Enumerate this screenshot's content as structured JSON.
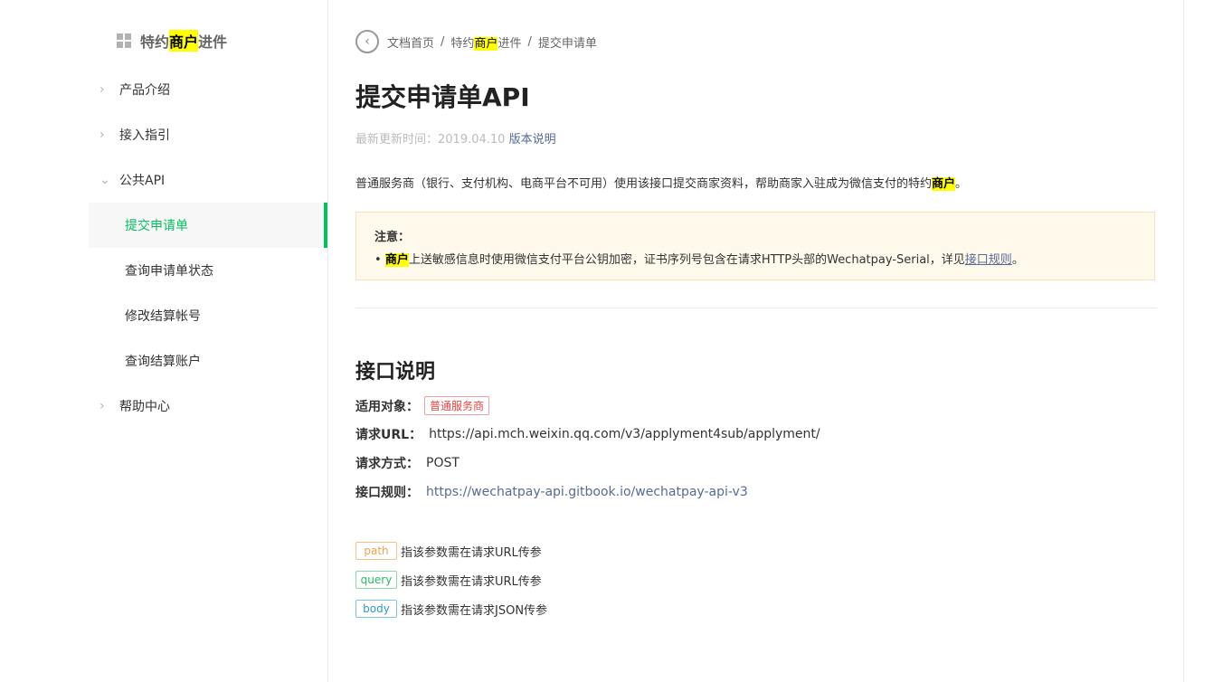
{
  "sidebar": {
    "brand": {
      "pre": "特约",
      "highlight": "商户",
      "post": "进件"
    },
    "items": [
      {
        "label": "产品介绍",
        "chevron": "›"
      },
      {
        "label": "接入指引",
        "chevron": "›"
      },
      {
        "label": "公共API",
        "chevron": "⌄"
      }
    ],
    "sub_items": [
      {
        "label": "提交申请单"
      },
      {
        "label": "查询申请单状态"
      },
      {
        "label": "修改结算帐号"
      },
      {
        "label": "查询结算账户"
      }
    ],
    "help": {
      "label": "帮助中心",
      "chevron": "›"
    }
  },
  "breadcrumb": {
    "back_icon": "‹",
    "home": "文档首页",
    "sep": "/",
    "section_pre": "特约",
    "section_highlight": "商户",
    "section_post": "进件",
    "current": "提交申请单"
  },
  "page": {
    "title": "提交申请单API",
    "update_label": "最新更新时间：2019.04.10",
    "version_link": "版本说明",
    "intro_pre": "普通服务商（银行、支付机构、电商平台不可用）使用该接口提交商家资料，帮助商家入驻成为微信支付的特约",
    "intro_highlight": "商户",
    "intro_post": "。"
  },
  "notice": {
    "title": "注意：",
    "bullet": "• ",
    "highlight": "商户",
    "text": "上送敏感信息时使用微信支付平台公钥加密，证书序列号包含在请求HTTP头部的Wechatpay-Serial，详见",
    "link": "接口规则",
    "end": "。"
  },
  "api": {
    "heading": "接口说明",
    "target_label": "适用对象：",
    "target_tag": "普通服务商",
    "url_label": "请求URL：",
    "url": "https://api.mch.weixin.qq.com/v3/applyment4sub/applyment/",
    "method_label": "请求方式：",
    "method": "POST",
    "rules_label": "接口规则：",
    "rules_link": "https://wechatpay-api.gitbook.io/wechatpay-api-v3"
  },
  "params": [
    {
      "tag": "path",
      "desc": "指该参数需在请求URL传参"
    },
    {
      "tag": "query",
      "desc": "指该参数需在请求URL传参"
    },
    {
      "tag": "body",
      "desc": "指该参数需在请求JSON传参"
    }
  ],
  "colors": {
    "accent": "#07c160",
    "link": "#576b95",
    "highlight": "#ffff00"
  }
}
